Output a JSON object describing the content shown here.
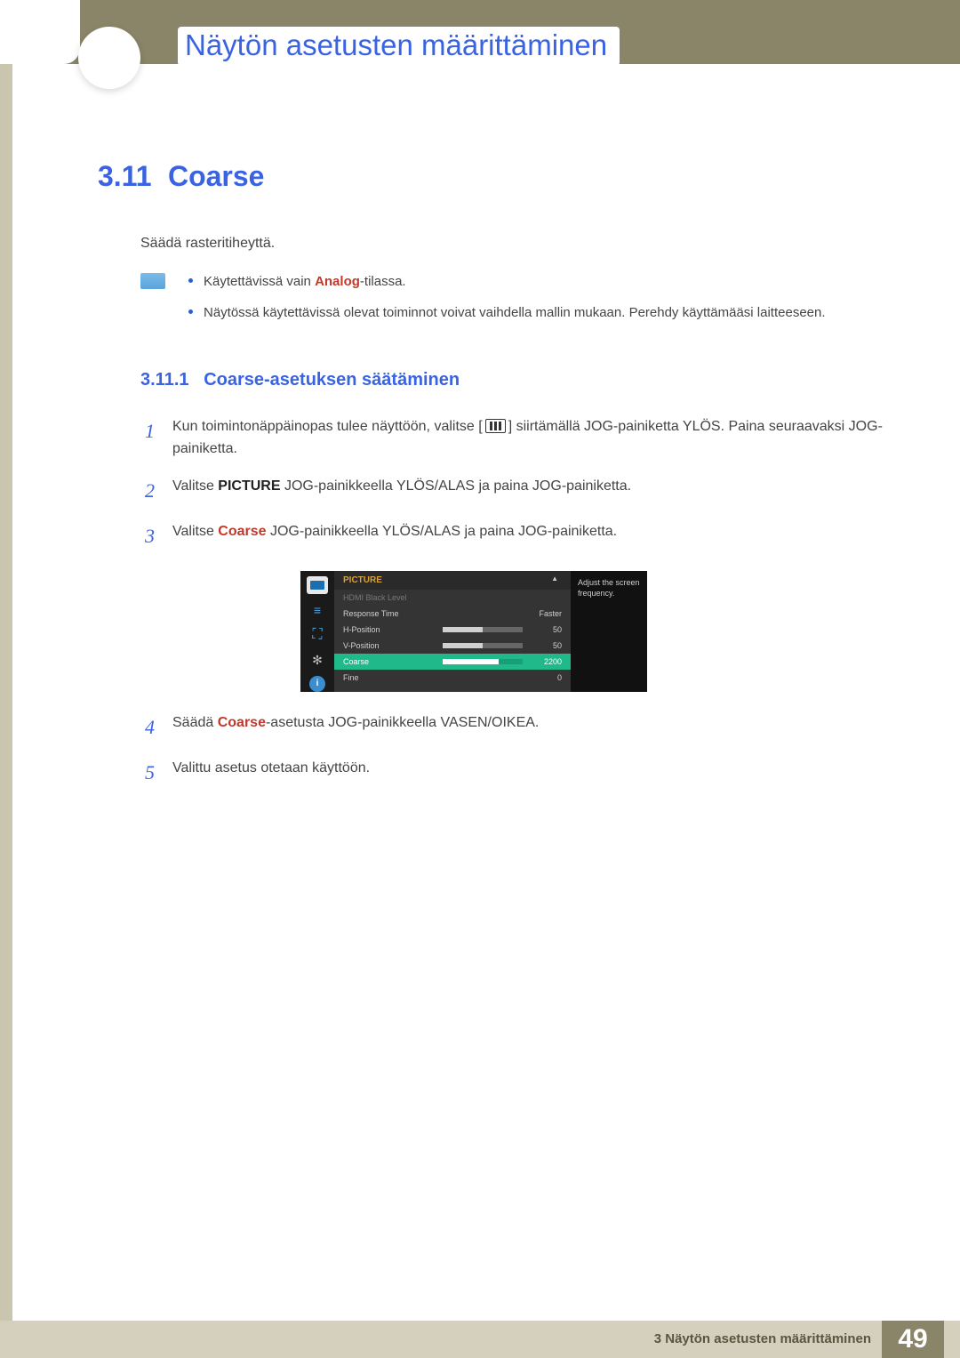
{
  "chapter_title": "Näytön asetusten määrittäminen",
  "section": {
    "num": "3.11",
    "title": "Coarse"
  },
  "intro": "Säädä rasteritiheyttä.",
  "notes": {
    "n1_pre": "Käytettävissä vain ",
    "n1_bold": "Analog",
    "n1_post": "-tilassa.",
    "n2": "Näytössä käytettävissä olevat toiminnot voivat vaihdella mallin mukaan. Perehdy käyttämääsi laitteeseen."
  },
  "subsection": {
    "num": "3.11.1",
    "title": "Coarse-asetuksen säätäminen"
  },
  "steps": {
    "s1a": "Kun toimintonäppäinopas tulee näyttöön, valitse [",
    "s1b": "] siirtämällä JOG-painiketta YLÖS. Paina seuraavaksi JOG-painiketta.",
    "s2_pre": "Valitse ",
    "s2_bold": "PICTURE",
    "s2_post": " JOG-painikkeella YLÖS/ALAS ja paina JOG-painiketta.",
    "s3_pre": "Valitse ",
    "s3_bold": "Coarse",
    "s3_post": " JOG-painikkeella YLÖS/ALAS ja paina JOG-painiketta.",
    "s4_pre": "Säädä ",
    "s4_bold": "Coarse",
    "s4_post": "-asetusta JOG-painikkeella VASEN/OIKEA.",
    "s5": "Valittu asetus otetaan käyttöön."
  },
  "osd": {
    "title": "PICTURE",
    "help": "Adjust the screen frequency.",
    "rows": [
      {
        "label": "HDMI Black Level",
        "value": "",
        "fill": 0,
        "dim": true
      },
      {
        "label": "Response Time",
        "value": "Faster",
        "fill": 0
      },
      {
        "label": "H-Position",
        "value": "50",
        "fill": 50
      },
      {
        "label": "V-Position",
        "value": "50",
        "fill": 50
      },
      {
        "label": "Coarse",
        "value": "2200",
        "fill": 70,
        "selected": true
      },
      {
        "label": "Fine",
        "value": "0",
        "fill": 0
      }
    ]
  },
  "footer": {
    "text": "3 Näytön asetusten määrittäminen",
    "page": "49"
  }
}
